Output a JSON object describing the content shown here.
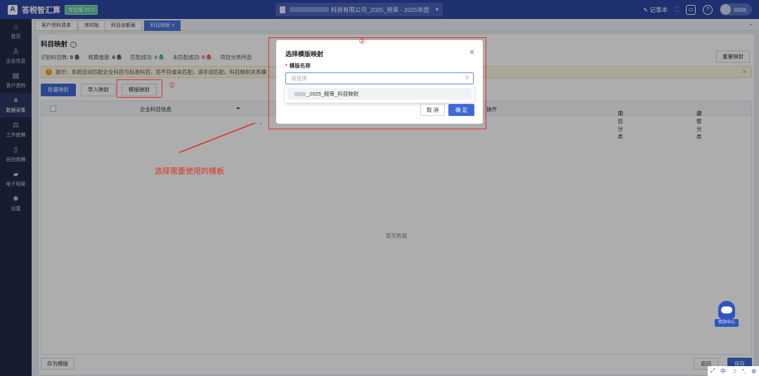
{
  "app": {
    "title": "答税智汇算",
    "version": "专业版 V2.0",
    "logo_letter": "A"
  },
  "company": {
    "visible_suffix": "科技有限公司_2025_税审 - 2025年度"
  },
  "topbar": {
    "notebook": "记事本"
  },
  "sidebar": {
    "items": [
      {
        "label": "首页",
        "icon": "home-icon"
      },
      {
        "label": "企业信息",
        "icon": "user-icon"
      },
      {
        "label": "客户资料",
        "icon": "id-card-icon"
      },
      {
        "label": "数据采集",
        "icon": "database-icon"
      },
      {
        "label": "工作底稿",
        "icon": "scale-icon"
      },
      {
        "label": "自由底稿",
        "icon": "document-icon"
      },
      {
        "label": "电子档案",
        "icon": "folder-icon"
      },
      {
        "label": "设置",
        "icon": "gear-icon"
      }
    ],
    "active": "数据采集"
  },
  "tabs": [
    "客户资料清单",
    "序时账",
    "科目余额表",
    "科目映射"
  ],
  "page": {
    "title": "科目映射",
    "reset_label": "重置映射",
    "stats": {
      "recognized_label": "识别科目数:",
      "recognized": "0 条",
      "dimension_label": "核算维度:",
      "dimension": "0 条",
      "matched_label": "匹配成功:",
      "matched": "0 条",
      "unmatched_label": "未匹配成功:",
      "unmatched": "0 条",
      "item_class_label": "项目分类待选"
    },
    "tip": "提示：系统自动匹配企业科目与标准科目，若不符或未匹配，请手动匹配。科目映射关系确",
    "buttons": {
      "batch": "批量映射",
      "import": "导入映射",
      "template": "模版映射"
    },
    "table": {
      "col_info": "企业科目信息",
      "col_op": "操作",
      "col_item": "项目分类",
      "col_adjust": "调整分类",
      "empty": "暂无数据"
    },
    "footer": {
      "save_template": "存为模版",
      "back": "返回",
      "save": "保存"
    }
  },
  "modal": {
    "title": "选择模版映射",
    "field_label": "模版名称",
    "required_mark": "*",
    "placeholder": "请选择",
    "option_suffix": "_2025_税审_科目映射",
    "cancel": "取 消",
    "confirm": "确 定"
  },
  "annotations": {
    "n1": "①",
    "n2": "②",
    "instruction": "选择需要使用的模板"
  },
  "todo": {
    "label": "待办中心"
  },
  "tray": {
    "ime": "中",
    "moon": "☽",
    "dot": "°,",
    "gear": "⚙"
  },
  "colors": {
    "primary": "#3d6ad6",
    "topbar": "#2e47a5",
    "sidebar": "#222b45",
    "annotation": "#e0302a"
  }
}
